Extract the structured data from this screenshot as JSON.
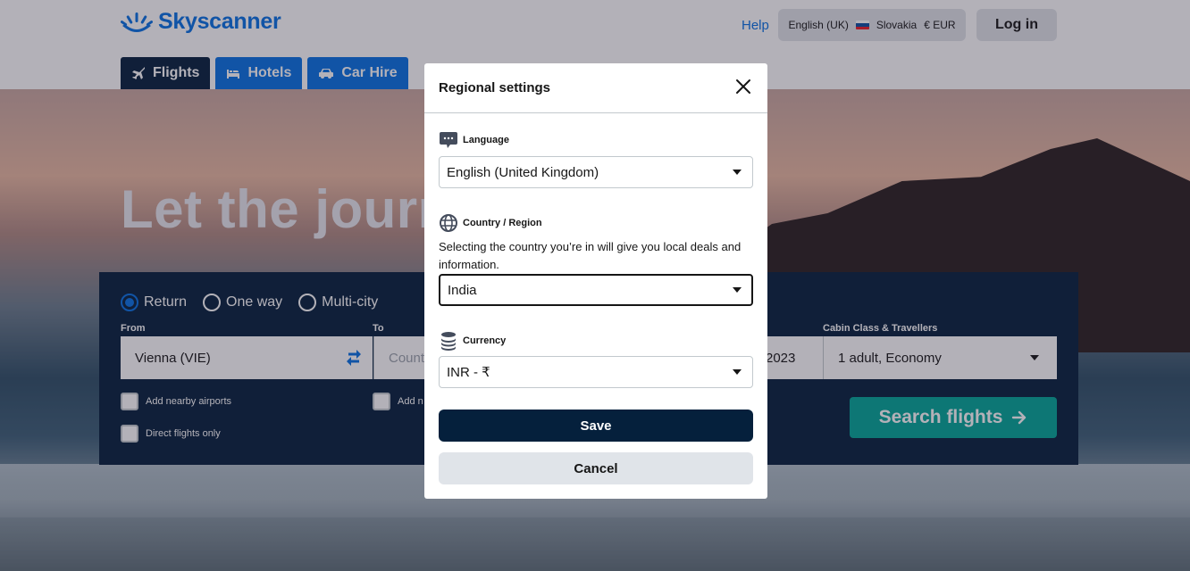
{
  "header": {
    "logo_text": "Skyscanner",
    "help": "Help",
    "locale": {
      "language": "English (UK)",
      "country": "Slovakia",
      "currency": "€ EUR"
    },
    "login": "Log in"
  },
  "nav_tabs": [
    {
      "label": "Flights",
      "icon": "plane-icon",
      "active": true
    },
    {
      "label": "Hotels",
      "icon": "bed-icon",
      "active": false
    },
    {
      "label": "Car Hire",
      "icon": "car-icon",
      "active": false
    }
  ],
  "hero": {
    "title": "Let the journey begin"
  },
  "search": {
    "trip_types": [
      {
        "label": "Return",
        "selected": true
      },
      {
        "label": "One way",
        "selected": false
      },
      {
        "label": "Multi-city",
        "selected": false
      }
    ],
    "from_label": "From",
    "from_value": "Vienna (VIE)",
    "to_label": "To",
    "to_placeholder": "Count",
    "date_partial": "2023",
    "cabin_label": "Cabin Class & Travellers",
    "cabin_value": "1 adult, Economy",
    "add_nearby_from": "Add nearby airports",
    "add_nearby_to_partial": "Add n",
    "direct_only": "Direct flights only",
    "search_button": "Search flights"
  },
  "modal": {
    "title": "Regional settings",
    "language_label": "Language",
    "language_value": "English (United Kingdom)",
    "country_label": "Country / Region",
    "country_desc": "Selecting the country you’re in will give you local deals and information.",
    "country_value": "India",
    "currency_label": "Currency",
    "currency_value": "INR - ₹",
    "save": "Save",
    "cancel": "Cancel"
  },
  "colors": {
    "brand_blue": "#0770e3",
    "dark_navy": "#05203c",
    "teal": "#00a698",
    "light_grey": "#e0e4e9"
  }
}
